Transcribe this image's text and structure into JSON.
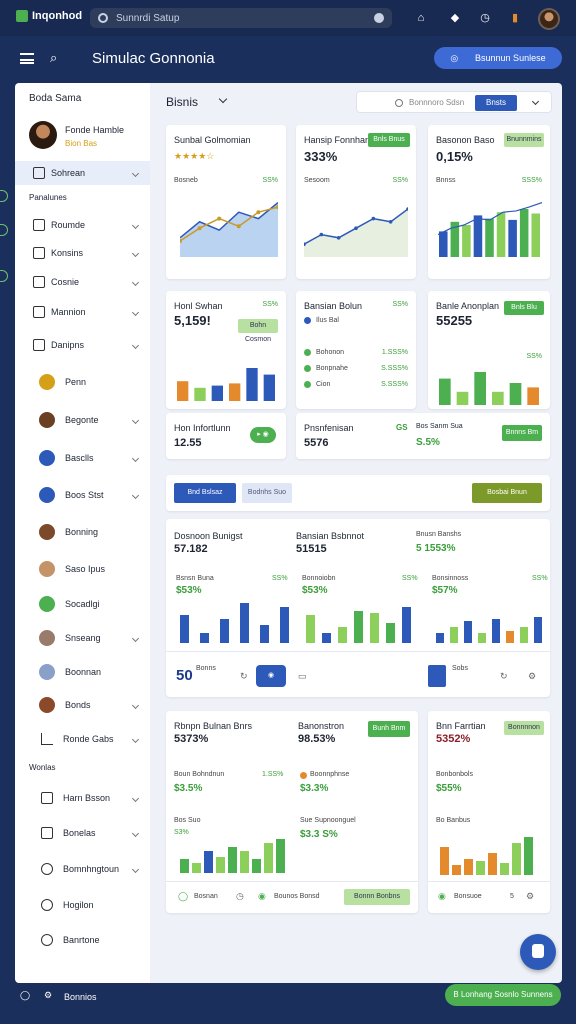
{
  "app": {
    "name": "Inqonhod",
    "search_placeholder": "Sunnrdi Satup"
  },
  "header": {
    "title": "Simulac Gonnonia",
    "action_button": "Bsunnun Sunlese"
  },
  "sidebar": {
    "title": "Boda Sama",
    "profile": {
      "name": "Fonde Hamble",
      "sub": "Bion Bas"
    },
    "active_item": "Sohrean",
    "section1": "Panalunes",
    "items1": [
      "Roumde",
      "Konsins",
      "Cosnie",
      "Mannion",
      "Danipns"
    ],
    "items2": [
      "Penn",
      "Begonte",
      "Basclls",
      "Boos Stst",
      "Bonning",
      "Saso Ipus",
      "Socadlgi",
      "Snseang",
      "Boonnan",
      "Bonds",
      "Ronde Gabs"
    ],
    "section2": "Wonlas",
    "items3": [
      "Harn Bsson",
      "Bonelas",
      "Bomnhngtoun",
      "Hogilon",
      "Banrtone"
    ],
    "footer_label": "Benongs"
  },
  "main": {
    "title": "Bisnis",
    "filter": {
      "placeholder": "Bonnnoro Sdsn",
      "button": "Bnsts"
    },
    "row1": [
      {
        "title": "Sunbal Golmomian",
        "rating": "★★★★☆",
        "axis_top": "Bosneb",
        "pct": "SS%"
      },
      {
        "title": "Hansip Fonnhan",
        "value": "333%",
        "pill": "Bnls Bnus",
        "axis_top": "Sesoom",
        "pct": "SS%"
      },
      {
        "title": "Basonon Baso",
        "value": "0,15%",
        "pill": "Bnunnmins",
        "axis_top": "Bnnss",
        "pct": "SSS%"
      }
    ],
    "row2": [
      {
        "title": "Honl Swhan",
        "value": "5,159!",
        "pct": "SS%",
        "pill": "Bohn Cosmon"
      },
      {
        "title": "Bansian Bolun",
        "pct": "SS%",
        "legend": [
          [
            "Ilus Bal",
            ""
          ],
          [
            "Bohonon",
            "1.SSS%"
          ],
          [
            "Bonpnahe",
            "S.SSS%"
          ],
          [
            "Cion",
            "S.SSS%"
          ]
        ]
      },
      {
        "title": "Banle Anonplan",
        "value": "55255",
        "pill": "Bnls Blu",
        "pct": "SS%"
      }
    ],
    "row3": [
      {
        "title": "Hon Infortlunn",
        "value": "12.55"
      },
      {
        "title": "Pnsnfenisan",
        "value": "5576",
        "pill_badge": "GS"
      },
      {
        "title": "Bos Sanm Sua",
        "value": "S.5%",
        "pill": "Bnnns Bm"
      }
    ],
    "tabs": [
      "Bnd Bslsaz",
      "Bodnhs Suo"
    ],
    "tab_action": "Bosbai Bnun",
    "wide": {
      "cols": [
        {
          "title": "Dosnoon Bunigst",
          "value": "57.182"
        },
        {
          "title": "Bansian Bsbnnot",
          "value": "51515"
        },
        {
          "title": "Bnusn Banshs",
          "value": "5 1553%"
        }
      ],
      "subs": [
        {
          "label": "Bsnsn Buna",
          "value": "$53%",
          "pct": "SS%"
        },
        {
          "label": "Bonnoiobn",
          "value": "$53%",
          "pct": "SS%"
        },
        {
          "label": "Bonsinnoss",
          "value": "$57%",
          "pct": "SS%"
        }
      ],
      "footer_value": "50",
      "footer_label": "Bonns",
      "footer_label2": "Sobs"
    },
    "bottom": [
      {
        "title": "Rbnpn Bulnan Bnrs",
        "value": "5373%",
        "sub1": "Boun Bohndnun",
        "sub1v": "$3.5%",
        "sub1p": "1.SS%",
        "sub2": "Bos Suo",
        "sub2v": "S3%",
        "footer": "Bosnan"
      },
      {
        "title": "Banonstron",
        "value": "98.53%",
        "pill": "Bunh Bnm",
        "sub1": "Boonnphnse",
        "sub1v": "$3.3%",
        "sub2": "Sue Supnoonguel",
        "sub2v": "$3.3 S%",
        "footer": "Bounos Bonsd",
        "footer_pill": "Bonnn Bonbns"
      },
      {
        "title": "Bnn Farrtian",
        "value": "5352%",
        "pill": "Bonnnnon",
        "sub1": "Bonbonbols",
        "sub1v": "$55%",
        "sub2": "Bo Banbus",
        "footer": "Bonsuoe",
        "footer_num": "5"
      }
    ]
  },
  "footer": {
    "label": "Bonnios",
    "button": "B Lonhang Sosnlo Sunnens"
  },
  "chart_data": [
    {
      "type": "area",
      "series": [
        {
          "values": [
            30,
            55,
            42,
            70,
            60,
            85
          ]
        }
      ]
    },
    {
      "type": "line",
      "series": [
        {
          "values": [
            20,
            35,
            30,
            45,
            60,
            55,
            75
          ]
        }
      ]
    },
    {
      "type": "bar",
      "series": [
        {
          "values": [
            40,
            55,
            50,
            65,
            60,
            70,
            58,
            75,
            68
          ]
        }
      ]
    },
    {
      "type": "bar",
      "series": [
        {
          "values": [
            45,
            30,
            35,
            40,
            75,
            60
          ]
        }
      ]
    },
    {
      "type": "bar",
      "series": [
        {
          "values": [
            60,
            30,
            75,
            30,
            50,
            40
          ]
        }
      ]
    }
  ],
  "colors": {
    "accent": "#2d5ab8",
    "green": "#4caf50",
    "orange": "#e5892d",
    "navy": "#1b2f5c"
  }
}
